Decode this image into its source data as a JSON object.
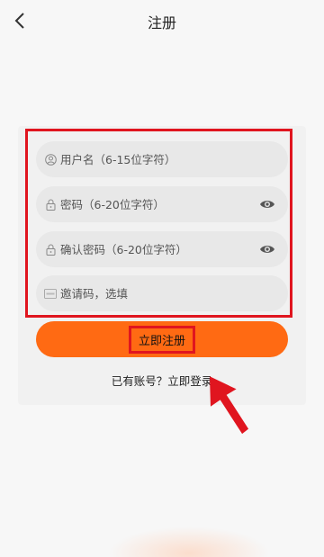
{
  "header": {
    "title": "注册"
  },
  "form": {
    "username": {
      "placeholder": "用户名（6-15位字符）",
      "value": ""
    },
    "password": {
      "placeholder": "密码（6-20位字符）",
      "value": ""
    },
    "confirm_password": {
      "placeholder": "确认密码（6-20位字符）",
      "value": ""
    },
    "invite_code": {
      "placeholder": "邀请码，选填",
      "value": ""
    },
    "submit_label": "立即注册"
  },
  "login": {
    "prompt": "已有账号？",
    "link_label": "立即登录"
  },
  "colors": {
    "accent": "#ff6a13",
    "highlight": "#e0151f",
    "field_bg": "#e8e8e8",
    "page_bg": "#f7f7f7"
  }
}
